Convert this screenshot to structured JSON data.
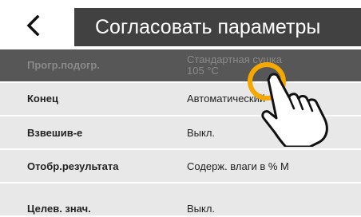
{
  "header": {
    "back_icon": "chevron-left-icon",
    "title": "Согласовать параметры"
  },
  "rows": [
    {
      "label": "Прогр.подогр.",
      "value_lines": [
        "Стандартная сушка",
        "105 °C"
      ]
    },
    {
      "label": "Конец",
      "value_lines": [
        "Автоматический"
      ]
    },
    {
      "label": "Взвешив-е",
      "value_lines": [
        "Выкл."
      ]
    },
    {
      "label": "Отобр.результата",
      "value_lines": [
        "Содерж. влаги в % M"
      ]
    },
    {
      "label": "Целев. знач.",
      "value_lines": [
        "Выкл."
      ]
    }
  ],
  "overlay": {
    "gesture_icon": "tap-hand-icon",
    "ring_color": "#f5a800"
  },
  "colors": {
    "title_bar": "#414141",
    "row_bg": "#e8e8e8",
    "selected_row_bg": "#575757"
  }
}
